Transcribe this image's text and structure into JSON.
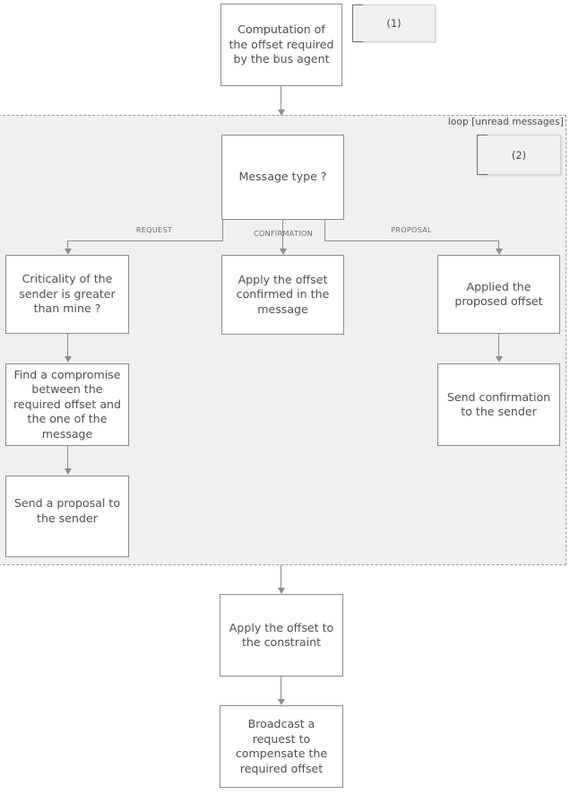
{
  "diagram": {
    "type": "activity-flowchart",
    "loop_frame": {
      "label": "loop [unread messages]"
    },
    "notes": [
      {
        "id": "note-1",
        "text": "(1)"
      },
      {
        "id": "note-2",
        "text": "(2)"
      }
    ],
    "nodes": [
      {
        "id": "computation-offset",
        "text": "Computation of the offset required by the bus agent"
      },
      {
        "id": "message-type",
        "text": "Message type ?"
      },
      {
        "id": "criticality-sender",
        "text": "Criticality of the sender is greater than mine ?"
      },
      {
        "id": "apply-offset-confirmed",
        "text": "Apply the offset confirmed in the message"
      },
      {
        "id": "applied-proposed-offset",
        "text": "Applied the proposed offset"
      },
      {
        "id": "find-compromise",
        "text": "Find a compromise between the required offset and the one of the message"
      },
      {
        "id": "send-confirmation",
        "text": "Send confirmation to the sender"
      },
      {
        "id": "send-proposal",
        "text": "Send a proposal to the sender"
      },
      {
        "id": "apply-offset-constraint",
        "text": "Apply the offset to the constraint"
      },
      {
        "id": "broadcast-request",
        "text": "Broadcast a request to compensate the required offset"
      }
    ],
    "edge_labels": [
      {
        "id": "branch-request",
        "text": "REQUEST"
      },
      {
        "id": "branch-confirmation",
        "text": "CONFIRMATION"
      },
      {
        "id": "branch-proposal",
        "text": "PROPOSAL"
      }
    ],
    "colors": {
      "page_background": "#ffffff",
      "loop_background": "#f0f0f0",
      "node_border": "#8c8c8c",
      "node_fill": "#ffffff",
      "text": "#4f4f4f",
      "connector": "#8c8c8c",
      "note_fill": "#f0f0f0",
      "note_bracket": "#6e6e6e"
    }
  }
}
